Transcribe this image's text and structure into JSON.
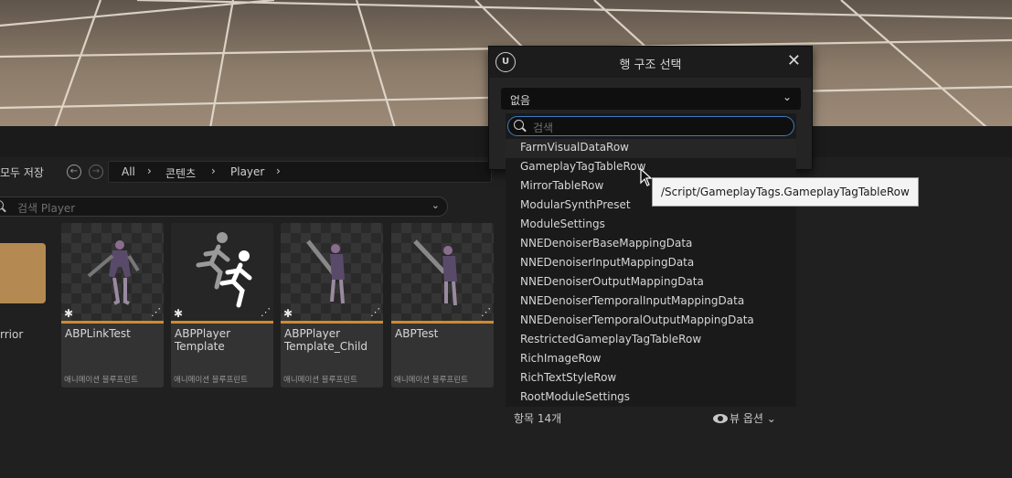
{
  "toolbar": {
    "save_all_label": "모두 저장",
    "breadcrumb": [
      "All",
      "콘텐츠",
      "Player"
    ]
  },
  "asset_search": {
    "placeholder": "검색 Player"
  },
  "folder": {
    "label": "rrior"
  },
  "assets": [
    {
      "name": "ABPLinkTest",
      "type": "애니메이션 블루프린트"
    },
    {
      "name": "ABPPlayer Template",
      "type": "애니메이션 블루프린트"
    },
    {
      "name": "ABPPlayer Template_Child",
      "type": "애니메이션 블루프린트"
    },
    {
      "name": "ABPTest",
      "type": "애니메이션 블루프린트"
    }
  ],
  "dialog": {
    "logo": "U",
    "title": "행 구조 선택",
    "close_glyph": "✕",
    "combo_value": "없음"
  },
  "dropdown": {
    "search_placeholder": "검색",
    "items": [
      "FarmVisualDataRow",
      "GameplayTagTableRow",
      "MirrorTableRow",
      "ModularSynthPreset",
      "ModuleSettings",
      "NNEDenoiserBaseMappingData",
      "NNEDenoiserInputMappingData",
      "NNEDenoiserOutputMappingData",
      "NNEDenoiserTemporalInputMappingData",
      "NNEDenoiserTemporalOutputMappingData",
      "RestrictedGameplayTagTableRow",
      "RichImageRow",
      "RichTextStyleRow",
      "RootModuleSettings"
    ],
    "item_count": "항목 14개",
    "view_options": "뷰 옵션"
  },
  "tooltip": "/Script/GameplayTags.GameplayTagTableRow",
  "colors": {
    "accent_orange": "#d08a2e",
    "focus_blue": "#3d7cc2"
  }
}
